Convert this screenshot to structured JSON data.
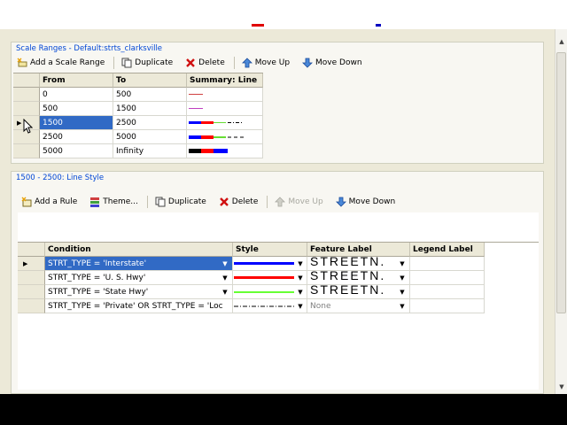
{
  "scale_ranges": {
    "title": "Scale Ranges - Default:strts_clarksville",
    "toolbar": {
      "add": "Add a Scale Range",
      "duplicate": "Duplicate",
      "delete": "Delete",
      "move_up": "Move Up",
      "move_down": "Move Down"
    },
    "columns": [
      "From",
      "To",
      "Summary: Line"
    ],
    "rows": [
      {
        "from": "0",
        "to": "500"
      },
      {
        "from": "500",
        "to": "1500"
      },
      {
        "from": "1500",
        "to": "2500",
        "selected": true
      },
      {
        "from": "2500",
        "to": "5000"
      },
      {
        "from": "5000",
        "to": "Infinity"
      }
    ]
  },
  "line_style": {
    "title": "1500 - 2500: Line Style",
    "toolbar": {
      "add_rule": "Add a Rule",
      "theme": "Theme...",
      "duplicate": "Duplicate",
      "delete": "Delete",
      "move_up": "Move Up",
      "move_down": "Move Down"
    },
    "columns": [
      "Condition",
      "Style",
      "Feature Label",
      "Legend Label"
    ],
    "rules": [
      {
        "condition": "STRT_TYPE = 'Interstate'",
        "style_color": "#0000ff",
        "feature_label": "STREETN.",
        "legend_label": "",
        "selected": true
      },
      {
        "condition": "STRT_TYPE = 'U. S. Hwy'",
        "style_color": "#ff0000",
        "feature_label": "STREETN.",
        "legend_label": ""
      },
      {
        "condition": "STRT_TYPE = 'State Hwy'",
        "style_color": "#66ff33",
        "feature_label": "STREETN.",
        "legend_label": ""
      },
      {
        "condition": "STRT_TYPE = 'Private' OR STRT_TYPE = 'Loc",
        "style_color": "#000000",
        "feature_label": "None",
        "legend_label": ""
      }
    ]
  },
  "colors": {
    "selection": "#316ac5",
    "group_title": "#0046d5",
    "panel": "#ece9d8"
  }
}
